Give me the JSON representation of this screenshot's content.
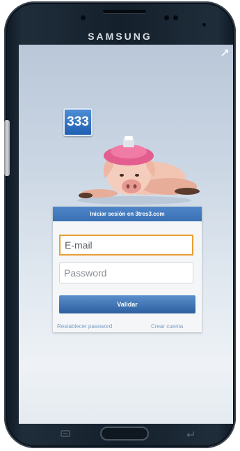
{
  "device": {
    "brand": "SAMSUNG"
  },
  "app": {
    "logo_text": "333"
  },
  "login": {
    "header": "Iniciar sesión en 3tres3.com",
    "email_placeholder": "E-mail",
    "password_placeholder": "Password",
    "submit_label": "Validar",
    "restore_link": "Restablecer password",
    "create_link": "Crear cuenta"
  },
  "colors": {
    "accent": "#3a70b4",
    "focus_border": "#e8a033",
    "link": "#7d9ec5"
  },
  "icons": [
    "expand-icon",
    "pig-mascot-image",
    "menu-icon",
    "back-icon"
  ]
}
